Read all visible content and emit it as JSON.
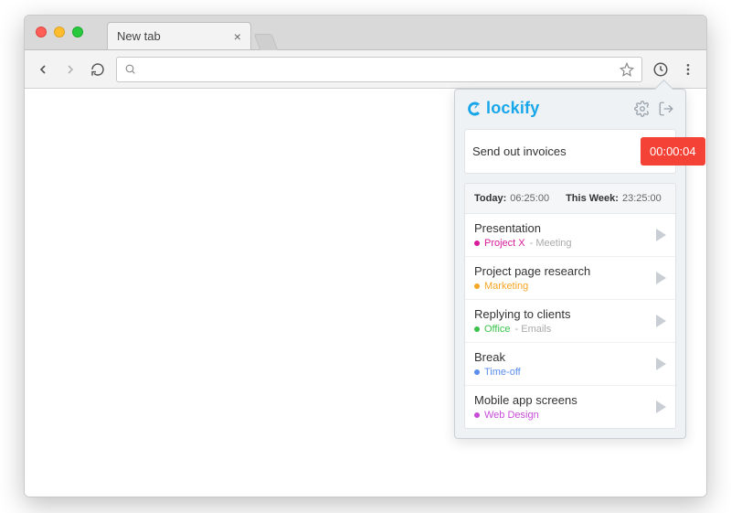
{
  "browser": {
    "tab_title": "New tab",
    "address_value": "",
    "address_placeholder": ""
  },
  "popup": {
    "brand": "lockify",
    "current_description": "Send out invoices",
    "timer_value": "00:00:04",
    "summary": {
      "today_label": "Today:",
      "today_value": "06:25:00",
      "week_label": "This Week:",
      "week_value": "23:25:00"
    },
    "entries": [
      {
        "title": "Presentation",
        "project": "Project X",
        "project_color": "#d81b9a",
        "task": "Meeting"
      },
      {
        "title": "Project page research",
        "project": "Marketing",
        "project_color": "#f5a623",
        "task": ""
      },
      {
        "title": "Replying to clients",
        "project": "Office",
        "project_color": "#3ac24b",
        "task": "Emails"
      },
      {
        "title": "Break",
        "project": "Time-off",
        "project_color": "#5b8def",
        "task": ""
      },
      {
        "title": "Mobile app screens",
        "project": "Web Design",
        "project_color": "#c84bd8",
        "task": ""
      }
    ]
  }
}
